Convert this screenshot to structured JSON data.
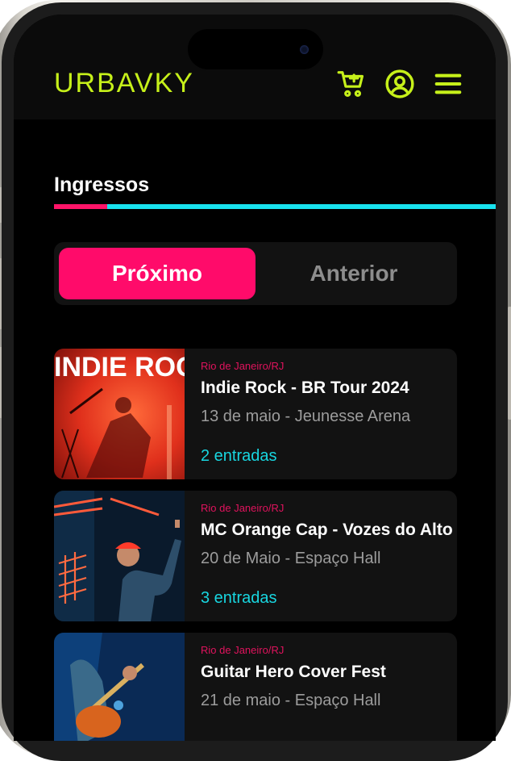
{
  "header": {
    "logo": "URBAVKY",
    "icons": [
      "cart-icon",
      "account-icon",
      "menu-icon"
    ],
    "accent_color": "#c6f01a"
  },
  "page": {
    "title": "Ingressos",
    "progress": 0.12
  },
  "tabs": {
    "active": "Próximo",
    "inactive": "Anterior"
  },
  "events": [
    {
      "location": "Rio de Janeiro/RJ",
      "title": "Indie Rock - BR Tour 2024",
      "date": "13 de maio - Jeunesse Arena",
      "tickets": "2 entradas",
      "poster_text": "INDIE ROCK"
    },
    {
      "location": "Rio de Janeiro/RJ",
      "title": "MC Orange Cap - Vozes do Alto",
      "date": "20 de Maio - Espaço Hall",
      "tickets": "3 entradas"
    },
    {
      "location": "Rio de Janeiro/RJ",
      "title": "Guitar Hero Cover Fest",
      "date": "21 de maio - Espaço Hall",
      "tickets": ""
    }
  ],
  "colors": {
    "pink": "#ff0b6a",
    "cyan": "#18e2ee",
    "background": "#000000"
  }
}
